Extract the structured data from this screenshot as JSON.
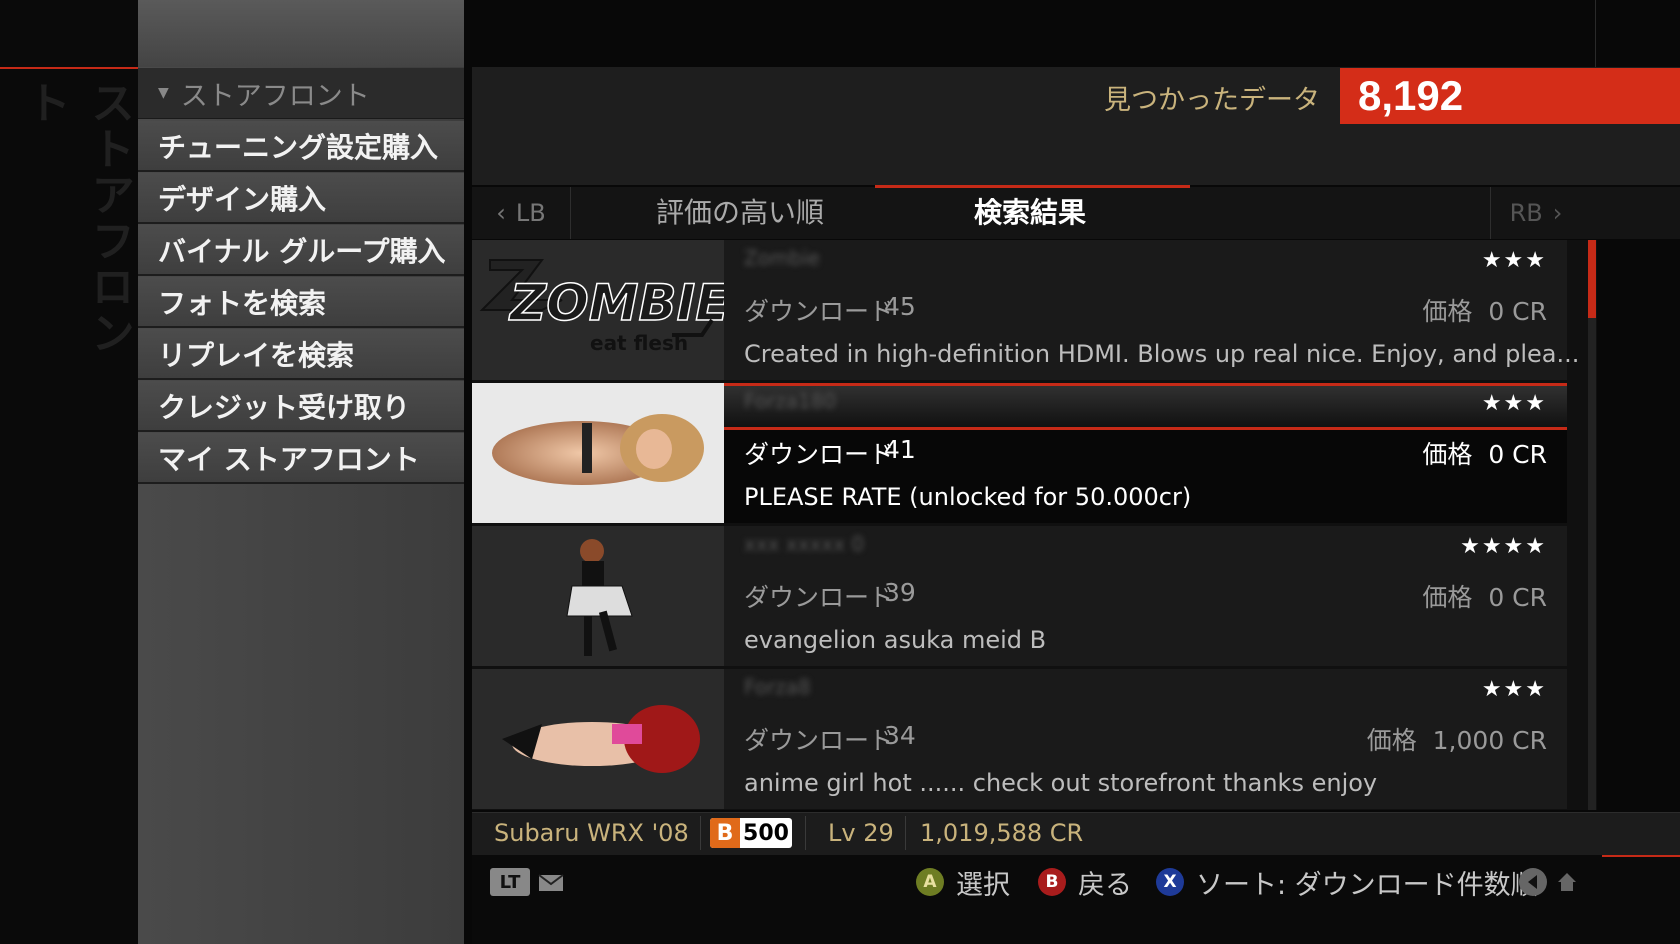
{
  "sidebar": {
    "vertical_title": "ストアフロント",
    "header": "ストアフロント",
    "items": [
      {
        "label": "チューニング設定購入"
      },
      {
        "label": "デザイン購入"
      },
      {
        "label": "バイナル グループ購入"
      },
      {
        "label": "フォトを検索"
      },
      {
        "label": "リプレイを検索"
      },
      {
        "label": "クレジット受け取り"
      },
      {
        "label": "マイ ストアフロント"
      }
    ]
  },
  "header": {
    "found_label": "見つかったデータ",
    "found_count": "8,192"
  },
  "tabs": {
    "lb": "LB",
    "rb": "RB",
    "items": [
      {
        "label": "評価の高い順"
      },
      {
        "label": "検索結果"
      }
    ]
  },
  "results": [
    {
      "name": "Zombie",
      "stars": "★★★",
      "download_label": "ダウンロード",
      "downloads": "45",
      "price_label": "価格",
      "price": "0 CR",
      "description": "Created in high-definition HDMI. Blows up real nice. Enjoy, and plea...",
      "thumb_text_1": "ZOMBIE",
      "thumb_text_2": "eat flesh"
    },
    {
      "name": "Forza180",
      "stars": "★★★",
      "download_label": "ダウンロード",
      "downloads": "41",
      "price_label": "価格",
      "price": "0 CR",
      "description": "PLEASE RATE (unlocked for 50.000cr)"
    },
    {
      "name": "xxx xxxxx 0",
      "stars": "★★★★",
      "download_label": "ダウンロード",
      "downloads": "39",
      "price_label": "価格",
      "price": "0 CR",
      "description": "evangelion asuka meid B"
    },
    {
      "name": "Forza8",
      "stars": "★★★",
      "download_label": "ダウンロード",
      "downloads": "34",
      "price_label": "価格",
      "price": "1,000 CR",
      "description": "anime girl hot ...... check out storefront thanks enjoy"
    }
  ],
  "status": {
    "car": "Subaru WRX '08",
    "class": "B",
    "pi": "500",
    "level": "Lv 29",
    "credits": "1,019,588 CR"
  },
  "footer": {
    "lt": "LT",
    "hints": [
      {
        "button": "A",
        "label": "選択",
        "color": "#7a8a2a"
      },
      {
        "button": "B",
        "label": "戻る",
        "color": "#b02020"
      },
      {
        "button": "X",
        "label": "ソート: ダウンロード件数順",
        "color": "#2040a0"
      }
    ]
  },
  "colors": {
    "accent": "#d42d18",
    "gold_text": "#c9b37c"
  }
}
